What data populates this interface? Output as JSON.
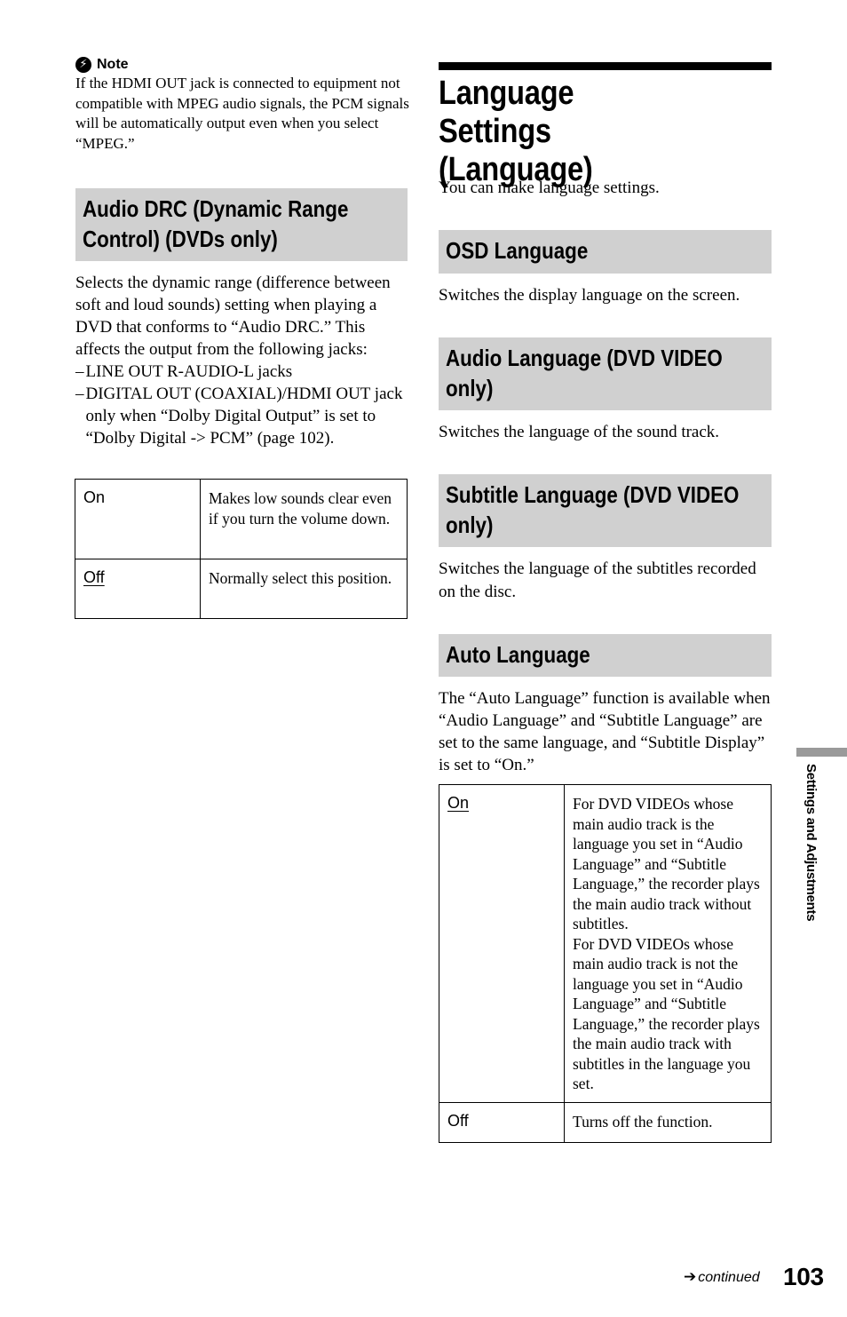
{
  "note": {
    "icon": "note-icon",
    "title": "Note",
    "text": "If the HDMI OUT jack is connected to equipment not compatible with MPEG audio signals, the PCM signals will be automatically output even when you select “MPEG.”"
  },
  "audio_drc": {
    "heading": "Audio DRC (Dynamic Range Control) (DVDs only)",
    "body": "Selects the dynamic range (difference between soft and loud sounds) setting when playing a DVD that conforms to “Audio DRC.” This affects the output from the following jacks:",
    "bullets": [
      "LINE OUT R-AUDIO-L jacks",
      "DIGITAL OUT (COAXIAL)/HDMI OUT jack only when “Dolby Digital Output” is set to “Dolby Digital -> PCM” (page 102)."
    ],
    "options": [
      {
        "key": "On",
        "default": false,
        "desc": "Makes low sounds clear even if you turn the volume down."
      },
      {
        "key": "Off",
        "default": true,
        "desc": "Normally select this position."
      }
    ]
  },
  "main": {
    "title": "Language Settings (Language)",
    "intro": "You can make language settings."
  },
  "osd": {
    "heading": "OSD Language",
    "body": "Switches the display language on the screen."
  },
  "audio_lang": {
    "heading": "Audio Language (DVD VIDEO only)",
    "body": "Switches the language of the sound track."
  },
  "subtitle_lang": {
    "heading": "Subtitle Language (DVD VIDEO only)",
    "body": "Switches the language of the subtitles recorded on the disc."
  },
  "auto_lang": {
    "heading": "Auto Language",
    "body": "The “Auto Language” function is available when “Audio Language” and “Subtitle Language” are set to the same language, and “Subtitle Display” is set to “On.”",
    "options": [
      {
        "key": "On",
        "default": true,
        "desc": "For DVD VIDEOs whose main audio track is the language you set in “Audio Language” and “Subtitle Language,” the recorder plays the main audio track without subtitles.\nFor DVD VIDEOs whose main audio track is not the language you set in “Audio Language” and “Subtitle Language,” the recorder plays the main audio track with subtitles in the language you set."
      },
      {
        "key": "Off",
        "default": false,
        "desc": "Turns off the function."
      }
    ]
  },
  "side_tab": "Settings and Adjustments",
  "footer": {
    "continued": "continued",
    "page_number": "103"
  }
}
